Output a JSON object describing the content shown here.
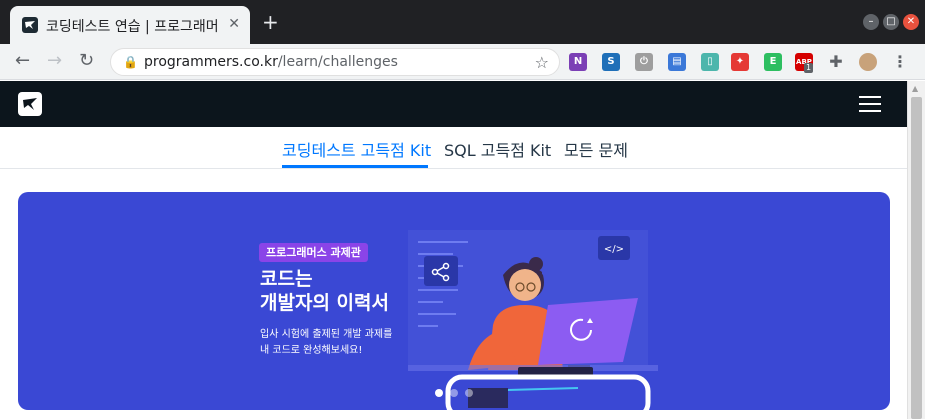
{
  "browser": {
    "tab_title": "코딩테스트 연습 | 프로그래머",
    "tab_close": "✕",
    "new_tab": "+",
    "url_domain": "programmers.co.kr",
    "url_path": "/learn/challenges",
    "extensions": [
      {
        "name": "onenote",
        "color": "#7b3fb5",
        "label": "N"
      },
      {
        "name": "s-ext",
        "color": "#1f6fb8",
        "label": "S"
      },
      {
        "name": "power",
        "color": "#9e9e9e",
        "label": "⏻"
      },
      {
        "name": "reader",
        "color": "#3b78d8",
        "label": "▤"
      },
      {
        "name": "book",
        "color": "#4db6ac",
        "label": "▯"
      },
      {
        "name": "colorful",
        "color": "#e53935",
        "label": "✦"
      },
      {
        "name": "evernote",
        "color": "#2dbe60",
        "label": "E"
      },
      {
        "name": "adblock",
        "color": "#d50000",
        "label": "ABP"
      },
      {
        "name": "puzzle",
        "color": "#5f6368",
        "label": "✚"
      },
      {
        "name": "profile",
        "color": "#c8a27a",
        "label": ""
      },
      {
        "name": "menu",
        "color": "#5f6368",
        "label": "⋮"
      }
    ],
    "adblock_count": "1"
  },
  "subnav": {
    "tabs": [
      {
        "label": "코딩테스트 고득점 Kit",
        "active": true
      },
      {
        "label": "SQL 고득점 Kit",
        "active": false
      },
      {
        "label": "모든 문제",
        "active": false
      }
    ]
  },
  "banner": {
    "badge": "프로그래머스 과제관",
    "headline_line1": "코드는",
    "headline_line2": "개발자의 이력서",
    "desc_line1": "입사 시험에 출제된 개발 과제를",
    "desc_line2": "내 코드로 완성해보세요!",
    "code_icon": "</>",
    "colors": {
      "background": "#3a48d4",
      "badge": "#8a44e8"
    }
  }
}
